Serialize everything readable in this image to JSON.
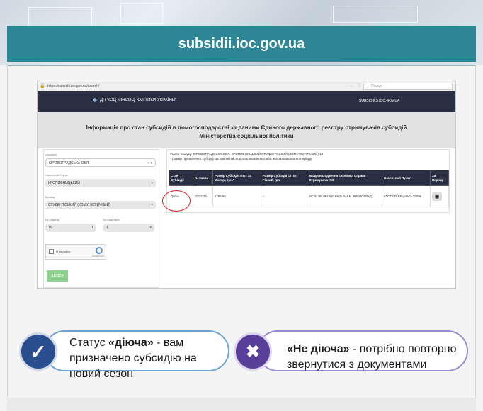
{
  "banner": {
    "title": "subsidii.ioc.gov.ua"
  },
  "browser": {
    "url": "https://subsidii.ioc.gov.ua/search/",
    "search_placeholder": "Пошук"
  },
  "site": {
    "logo_text": "ДП \"ІОЦ МІНСОЦПОЛІТИКИ УКРАЇНИ\"",
    "top_link": "SUBSIDIES.IOC.GOV.UA",
    "heading_line1": "Інформація про стан субсидій в домогосподарстві за даними Єдиного державного реєстру отримувачів субсидій",
    "heading_line2": "Міністерства соціальної політики"
  },
  "form": {
    "region_label": "Область",
    "region_value": "КІРОВОГРАДСЬКА ОБЛ.",
    "city_label": "Населений Пункт",
    "city_value": "КРОПИВНИЦЬКИЙ",
    "street_label": "Вулиця",
    "street_value": "СТУДЕНТСЬКИЙ (КОМУНІСТИЧНИЙ)",
    "house_label": "№ Будинку",
    "house_value": "10",
    "apt_label": "№ Квартири",
    "apt_value": "1",
    "captcha_label": "Я не робот",
    "captcha_brand": "reCAPTCHA",
    "submit_label": "Шукати"
  },
  "result": {
    "conditions": "Умови пошуку: КІРОВОГРАДСЬКА ОБЛ. КРОПИВНИЦЬКИЙ СТУДЕНТСЬКИЙ (КОМУНІСТИЧНИЙ) 10",
    "note": "* розмір призначеної субсидії за повний місяць опалювального або неопалювального періоду",
    "columns": [
      "Стан Субсидії",
      "№ Заяви",
      "Розмір Субсидії ЖКП За Місяць, грн.*",
      "Розмір Субсидії СГПП Річний, грн.",
      "Місцезнаходження Особової Справи Отримувача ЖС",
      "Населений Пункт",
      "За Період"
    ],
    "row": {
      "status": "Діюча",
      "app_no": "*******75",
      "amount": "1796.56",
      "sgpp": "--",
      "location": "УСЗН ВК ЛЕНІНСЬКОЇ Р-Н М. КРОВОГРАД",
      "city": "КРОПИВНИЦЬКИЙ-25006"
    }
  },
  "cards": {
    "left_prefix": "Статус ",
    "left_bold": "«діюча»",
    "left_suffix": " - вам призначено субсидію на новий сезон",
    "right_bold": "«Не діюча»",
    "right_suffix": " -  потрібно повторно звернутися з документами"
  },
  "colors": {
    "accent": "#2e8596",
    "header": "#2b2f44",
    "check_badge": "#2a4f8e",
    "cross_badge": "#5a3f9a"
  }
}
